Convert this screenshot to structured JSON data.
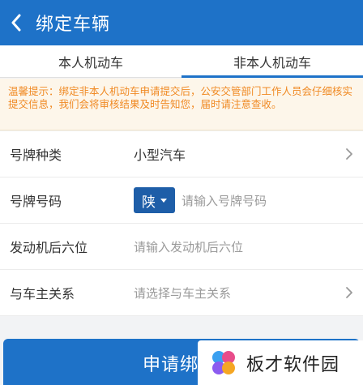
{
  "header": {
    "title": "绑定车辆"
  },
  "tabs": [
    {
      "label": "本人机动车"
    },
    {
      "label": "非本人机动车"
    }
  ],
  "notice": {
    "text": "温馨提示：绑定非本人机动车申请提交后，公安交管部门工作人员会仔细核实提交信息，我们会将审核结果及时告知您，届时请注意查收。"
  },
  "form": {
    "plate_type": {
      "label": "号牌种类",
      "value": "小型汽车"
    },
    "plate_number": {
      "label": "号牌号码",
      "province": "陕",
      "placeholder": "请输入号牌号码"
    },
    "engine": {
      "label": "发动机后六位",
      "placeholder": "请输入发动机后六位"
    },
    "relation": {
      "label": "与车主关系",
      "placeholder": "请选择与车主关系"
    }
  },
  "submit": {
    "label": "申请绑"
  },
  "watermark": {
    "text": "板才软件园"
  },
  "colors": {
    "primary": "#1e72c8",
    "notice_text": "#f08a24"
  }
}
